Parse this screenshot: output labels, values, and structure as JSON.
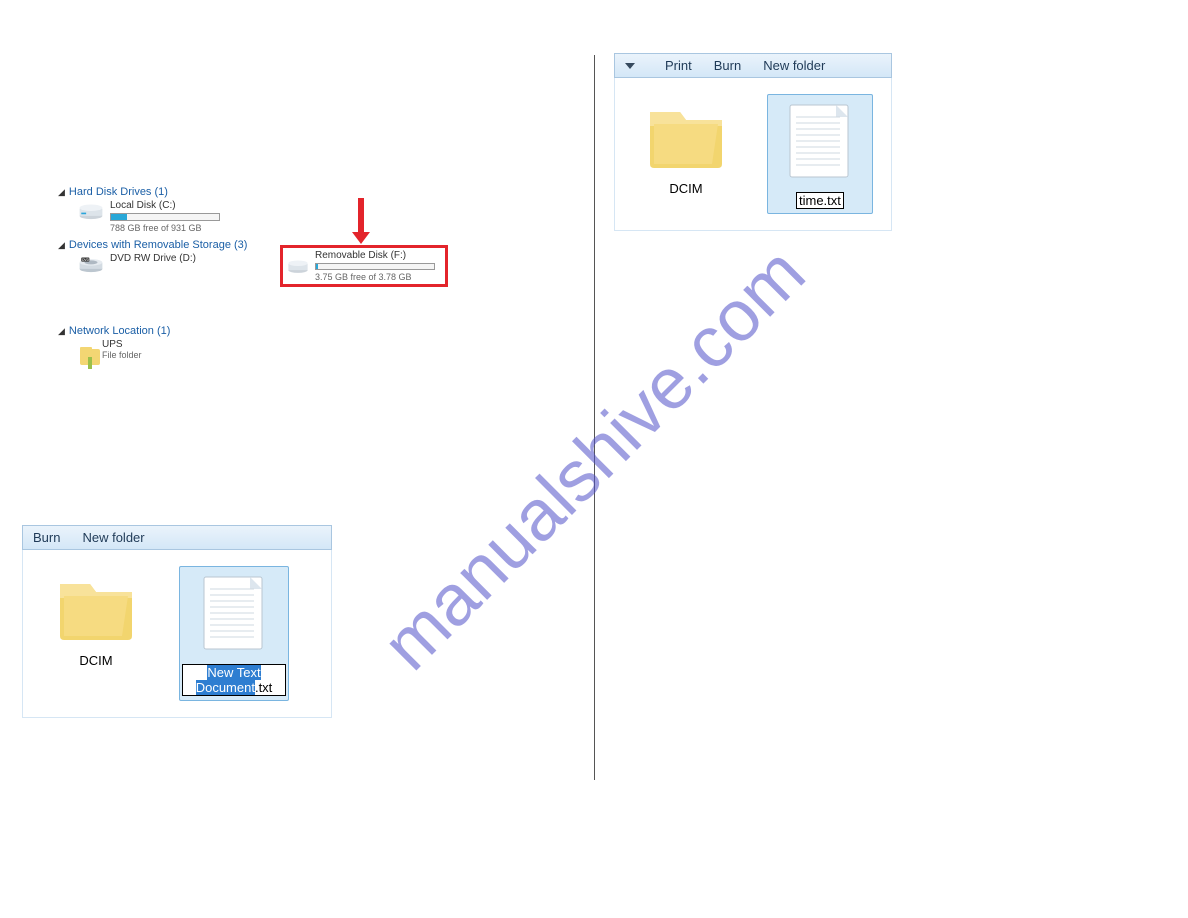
{
  "watermark_text": "manualshive.com",
  "panel1": {
    "group1": {
      "label": "Hard Disk Drives (1)"
    },
    "local_disk": {
      "name": "Local Disk (C:)",
      "free": "788 GB free of 931 GB",
      "fill_pct": 15
    },
    "group2": {
      "label": "Devices with Removable Storage (3)"
    },
    "dvd": {
      "name": "DVD RW Drive (D:)"
    },
    "removable": {
      "name": "Removable Disk (F:)",
      "free": "3.75 GB free of 3.78 GB",
      "fill_pct": 2
    },
    "group3": {
      "label": "Network Location (1)"
    },
    "ups": {
      "name": "UPS",
      "sub": "File folder"
    }
  },
  "panel2": {
    "toolbar": {
      "burn": "Burn",
      "newfolder": "New folder"
    },
    "dcim": "DCIM",
    "newdoc_hl": "New Text Document",
    "newdoc_ext": ".txt"
  },
  "panel3": {
    "toolbar": {
      "print": "Print",
      "burn": "Burn",
      "newfolder": "New folder"
    },
    "dcim": "DCIM",
    "timefile": "time.txt"
  }
}
